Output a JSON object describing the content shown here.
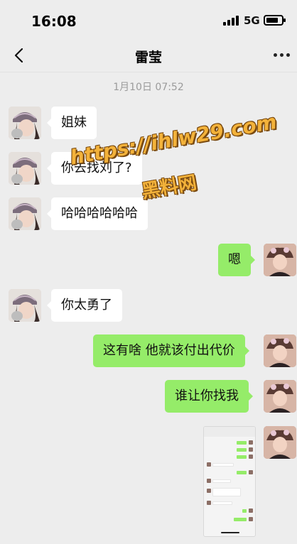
{
  "status_bar": {
    "time": "16:08",
    "network": "5G",
    "icons": [
      "signal-icon",
      "battery-icon"
    ]
  },
  "header": {
    "title": "雷莹",
    "icons": [
      "back-icon",
      "more-icon"
    ]
  },
  "timestamp": "1月10日 07:52",
  "messages": [
    {
      "from": "contact",
      "text": "姐妹"
    },
    {
      "from": "contact",
      "text": "你去找刘了?"
    },
    {
      "from": "contact",
      "text": "哈哈哈哈哈哈"
    },
    {
      "from": "me",
      "text": "嗯"
    },
    {
      "from": "contact",
      "text": "你太勇了"
    },
    {
      "from": "me",
      "text": "这有啥 他就该付出代价"
    },
    {
      "from": "me",
      "text": "谁让你找我"
    },
    {
      "from": "me",
      "type": "image",
      "content": "screenshot-thumbnail"
    }
  ],
  "watermark": {
    "url": "https://ihlw29.com",
    "label": "黑料网"
  },
  "colors": {
    "background": "#ededed",
    "incoming_bubble": "#ffffff",
    "outgoing_bubble": "#95ec69",
    "watermark": "#f3b23a"
  }
}
